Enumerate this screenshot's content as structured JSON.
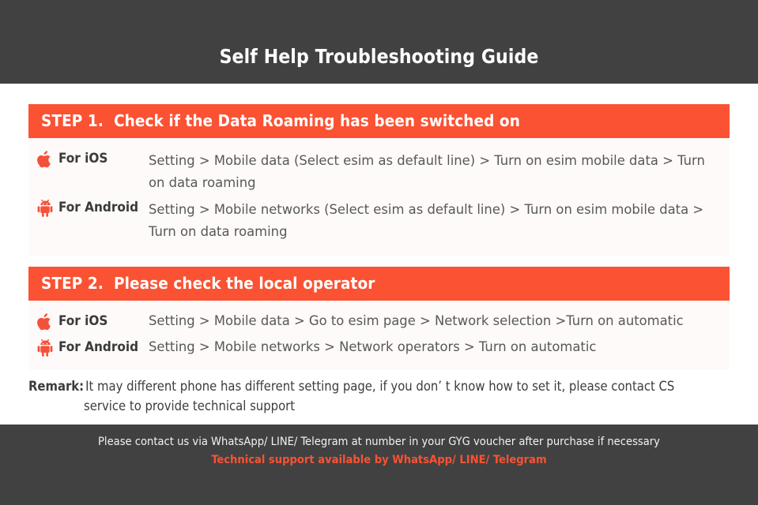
{
  "header": {
    "title": "Self Help Troubleshooting Guide",
    "background_color": "#414141",
    "text_color": "#FFFFFF"
  },
  "theme": {
    "accent_color": "#FA5233",
    "panel_background": "#FEFAF9",
    "label_text_color": "#3A3A3A",
    "body_text_color": "#585858"
  },
  "steps": [
    {
      "banner": "STEP 1.  Check if the Data Roaming has been switched on",
      "rows": [
        {
          "icon": "apple-logo-icon",
          "platform": "For iOS",
          "instructions": "Setting > Mobile data (Select esim as default line) > Turn on esim mobile data > Turn on data roaming"
        },
        {
          "icon": "android-robot-icon",
          "platform": "For Android",
          "instructions": "Setting > Mobile networks (Select esim as default line) > Turn on esim mobile data > Turn on data roaming"
        }
      ]
    },
    {
      "banner": "STEP 2.  Please check the local operator",
      "rows": [
        {
          "icon": "apple-logo-icon",
          "platform": "For iOS",
          "instructions": "Setting > Mobile data > Go to esim page > Network selection >Turn on automatic"
        },
        {
          "icon": "android-robot-icon",
          "platform": "For Android",
          "instructions": "Setting > Mobile networks > Network operators > Turn on automatic"
        }
      ]
    }
  ],
  "remark": {
    "label": "Remark:",
    "line1": "It may different phone has different setting page, if you don’ t know how to set it,  please contact CS",
    "line2": "service to provide technical support"
  },
  "footer": {
    "line1": "Please contact us via WhatsApp/ LINE/ Telegram at number in your GYG voucher after purchase if necessary",
    "line2": "Technical support available by WhatsApp/ LINE/ Telegram",
    "background_color": "#414141",
    "line2_color": "#FA5233"
  }
}
